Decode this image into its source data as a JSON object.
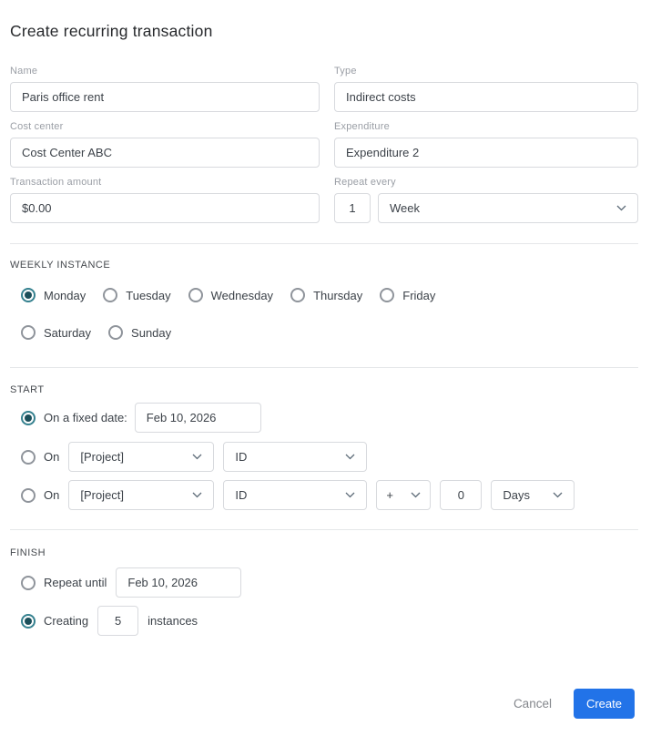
{
  "title": "Create recurring transaction",
  "colors": {
    "radio_selected_ring": "#35818F",
    "radio_selected_dot": "#1C4F5A",
    "primary_button": "#2273E8",
    "input_border": "#D8DADE",
    "divider": "#E5E7E9"
  },
  "icons": {
    "select_chevron": "chevron-down"
  },
  "fields": {
    "name": {
      "label": "Name",
      "value": "Paris office rent"
    },
    "type": {
      "label": "Type",
      "value": "Indirect costs"
    },
    "cost_center": {
      "label": "Cost center",
      "value": "Cost Center ABC"
    },
    "expenditure": {
      "label": "Expenditure",
      "value": "Expenditure 2"
    },
    "transaction_amount": {
      "label": "Transaction amount",
      "value": "$0.00"
    },
    "repeat_every": {
      "label": "Repeat every",
      "interval": "1",
      "unit": "Week"
    }
  },
  "weekly_instance": {
    "heading": "WEEKLY INSTANCE",
    "days": [
      {
        "label": "Monday",
        "selected": true
      },
      {
        "label": "Tuesday",
        "selected": false
      },
      {
        "label": "Wednesday",
        "selected": false
      },
      {
        "label": "Thursday",
        "selected": false
      },
      {
        "label": "Friday",
        "selected": false
      },
      {
        "label": "Saturday",
        "selected": false
      },
      {
        "label": "Sunday",
        "selected": false
      }
    ]
  },
  "start": {
    "heading": "START",
    "fixed_date": {
      "label": "On a fixed date:",
      "selected": true,
      "value": "Feb 10, 2026"
    },
    "on_project": {
      "label": "On",
      "selected": false,
      "project": "[Project]",
      "reference": "ID"
    },
    "on_project_offset": {
      "label": "On",
      "selected": false,
      "project": "[Project]",
      "reference": "ID",
      "operator": "+",
      "amount": "0",
      "unit": "Days"
    }
  },
  "finish": {
    "heading": "FINISH",
    "repeat_until": {
      "label": "Repeat until",
      "selected": false,
      "value": "Feb 10, 2026"
    },
    "creating": {
      "label": "Creating",
      "selected": true,
      "count": "5",
      "suffix": "instances"
    }
  },
  "footer": {
    "cancel_label": "Cancel",
    "create_label": "Create"
  }
}
